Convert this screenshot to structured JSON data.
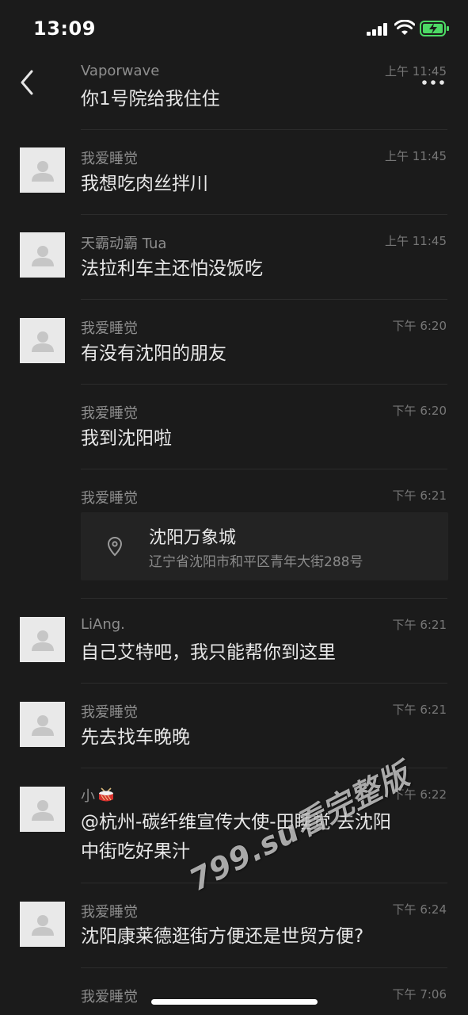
{
  "status": {
    "time": "13:09"
  },
  "colors": {
    "background": "#1b1b1b",
    "battery": "#4cd964"
  },
  "icons": {
    "back": "chevron-left-icon",
    "more": "more-dots-icon",
    "location": "location-pin-icon"
  },
  "messages": [
    {
      "sender": "Vaporwave",
      "time": "上午 11:45",
      "text": "你1号院给我住住",
      "avatar": false
    },
    {
      "sender": "我爱睡觉",
      "time": "上午 11:45",
      "text": "我想吃肉丝拌川",
      "avatar": true
    },
    {
      "sender": "天霸动霸 Tua",
      "time": "上午 11:45",
      "text": "法拉利车主还怕没饭吃",
      "avatar": true
    },
    {
      "sender": "我爱睡觉",
      "time": "下午 6:20",
      "text": "有没有沈阳的朋友",
      "avatar": true
    },
    {
      "sender": "我爱睡觉",
      "time": "下午 6:20",
      "text": "我到沈阳啦",
      "avatar": false
    },
    {
      "sender": "我爱睡觉",
      "time": "下午 6:21",
      "location": {
        "name": "沈阳万象城",
        "address": "辽宁省沈阳市和平区青年大街288号"
      },
      "avatar": false
    },
    {
      "sender": "LiAng.",
      "time": "下午 6:21",
      "text": "自己艾特吧，我只能帮你到这里",
      "avatar": true
    },
    {
      "sender": "我爱睡觉",
      "time": "下午 6:21",
      "text": "先去找车晚晚",
      "avatar": true
    },
    {
      "sender": "小",
      "time": "下午 6:22",
      "text_line1": "@杭州-碳纤维宣传大使-田睡觉 去沈阳",
      "text_line2": "中街吃好果汁",
      "avatar": true
    },
    {
      "sender": "我爱睡觉",
      "time": "下午 6:24",
      "text": "沈阳康莱德逛街方便还是世贸方便?",
      "avatar": true
    },
    {
      "sender": "我爱睡觉",
      "time": "下午 7:06",
      "avatar": false
    }
  ],
  "watermark": "799.su看完整版"
}
